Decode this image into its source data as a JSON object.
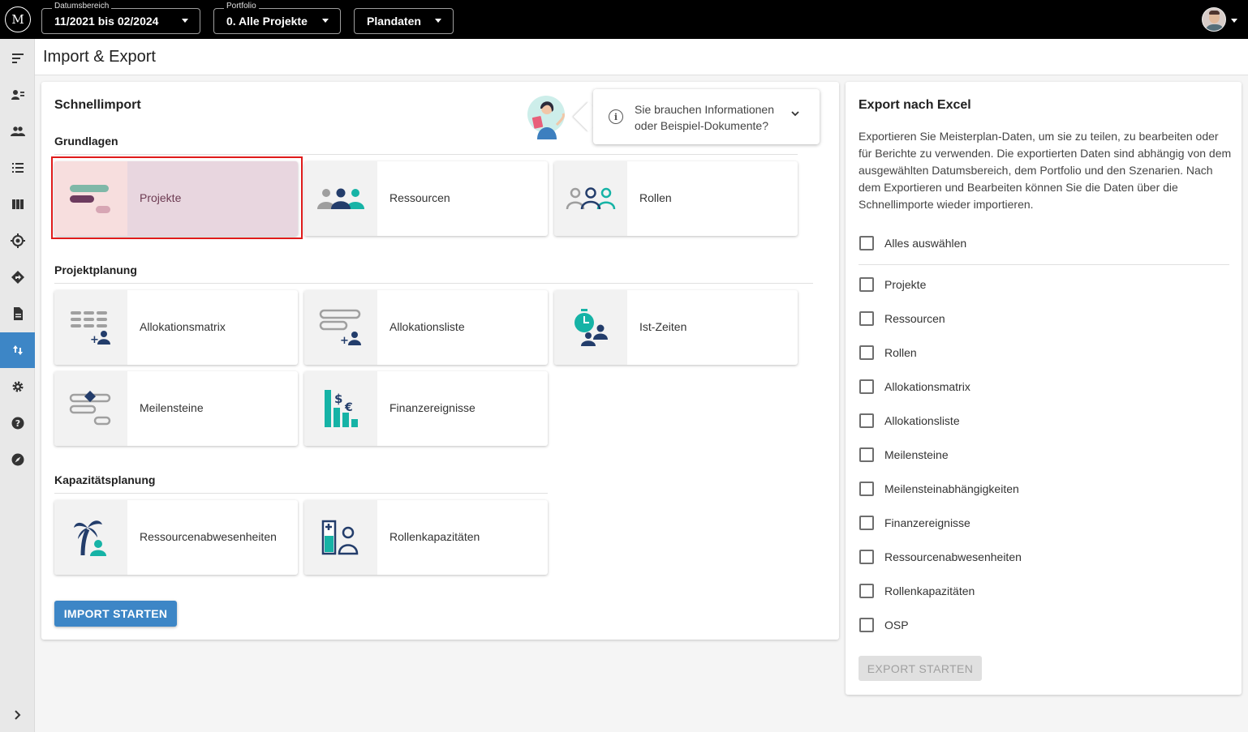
{
  "topbar": {
    "logo": "M",
    "date_range": {
      "label": "Datumsbereich",
      "value": "11/2021 bis 02/2024"
    },
    "portfolio": {
      "label": "Portfolio",
      "value": "0. Alle Projekte"
    },
    "plan_data": {
      "value": "Plandaten"
    }
  },
  "page": {
    "title": "Import & Export"
  },
  "schnellimport": {
    "title": "Schnellimport",
    "info": {
      "line1": "Sie brauchen Informationen",
      "line2": "oder Beispiel-Dokumente?"
    },
    "sections": {
      "grundlagen": "Grundlagen",
      "projektplanung": "Projektplanung",
      "kapazitaet": "Kapazitätsplanung"
    },
    "tiles": {
      "projekte": "Projekte",
      "ressourcen": "Ressourcen",
      "rollen": "Rollen",
      "allokationsmatrix": "Allokationsmatrix",
      "allokationsliste": "Allokationsliste",
      "istzeiten": "Ist-Zeiten",
      "meilensteine": "Meilensteine",
      "finanzereignisse": "Finanzereignisse",
      "ressourcenabwesenheiten": "Ressourcenabwesenheiten",
      "rollenkapazitaeten": "Rollenkapazitäten"
    },
    "start_button": "IMPORT STARTEN"
  },
  "export": {
    "title": "Export nach Excel",
    "description": "Exportieren Sie Meisterplan-Daten, um sie zu teilen, zu bearbeiten oder für Berichte zu verwenden. Die exportierten Daten sind abhängig von dem ausgewählten Datumsbereich, dem Portfolio und den Szenarien. Nach dem Exportieren und Bearbeiten können Sie die Daten über die Schnellimporte wieder importieren.",
    "select_all": "Alles auswählen",
    "items": [
      "Projekte",
      "Ressourcen",
      "Rollen",
      "Allokationsmatrix",
      "Allokationsliste",
      "Meilensteine",
      "Meilensteinabhängigkeiten",
      "Finanzereignisse",
      "Ressourcenabwesenheiten",
      "Rollenkapazitäten",
      "OSP"
    ],
    "start_button": "EXPORT STARTEN"
  },
  "colors": {
    "accent": "#3d86c6",
    "navy": "#233d6b",
    "teal": "#16b3a6",
    "plum": "#6d3b5f",
    "selection_outline": "#e01b1b"
  }
}
